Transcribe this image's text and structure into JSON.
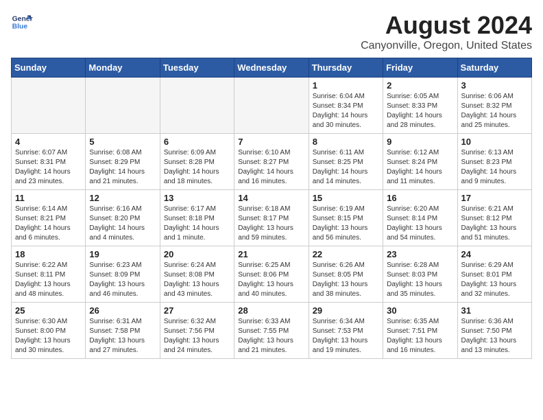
{
  "header": {
    "logo_line1": "General",
    "logo_line2": "Blue",
    "month_year": "August 2024",
    "location": "Canyonville, Oregon, United States"
  },
  "weekdays": [
    "Sunday",
    "Monday",
    "Tuesday",
    "Wednesday",
    "Thursday",
    "Friday",
    "Saturday"
  ],
  "weeks": [
    [
      {
        "day": "",
        "info": ""
      },
      {
        "day": "",
        "info": ""
      },
      {
        "day": "",
        "info": ""
      },
      {
        "day": "",
        "info": ""
      },
      {
        "day": "1",
        "info": "Sunrise: 6:04 AM\nSunset: 8:34 PM\nDaylight: 14 hours\nand 30 minutes."
      },
      {
        "day": "2",
        "info": "Sunrise: 6:05 AM\nSunset: 8:33 PM\nDaylight: 14 hours\nand 28 minutes."
      },
      {
        "day": "3",
        "info": "Sunrise: 6:06 AM\nSunset: 8:32 PM\nDaylight: 14 hours\nand 25 minutes."
      }
    ],
    [
      {
        "day": "4",
        "info": "Sunrise: 6:07 AM\nSunset: 8:31 PM\nDaylight: 14 hours\nand 23 minutes."
      },
      {
        "day": "5",
        "info": "Sunrise: 6:08 AM\nSunset: 8:29 PM\nDaylight: 14 hours\nand 21 minutes."
      },
      {
        "day": "6",
        "info": "Sunrise: 6:09 AM\nSunset: 8:28 PM\nDaylight: 14 hours\nand 18 minutes."
      },
      {
        "day": "7",
        "info": "Sunrise: 6:10 AM\nSunset: 8:27 PM\nDaylight: 14 hours\nand 16 minutes."
      },
      {
        "day": "8",
        "info": "Sunrise: 6:11 AM\nSunset: 8:25 PM\nDaylight: 14 hours\nand 14 minutes."
      },
      {
        "day": "9",
        "info": "Sunrise: 6:12 AM\nSunset: 8:24 PM\nDaylight: 14 hours\nand 11 minutes."
      },
      {
        "day": "10",
        "info": "Sunrise: 6:13 AM\nSunset: 8:23 PM\nDaylight: 14 hours\nand 9 minutes."
      }
    ],
    [
      {
        "day": "11",
        "info": "Sunrise: 6:14 AM\nSunset: 8:21 PM\nDaylight: 14 hours\nand 6 minutes."
      },
      {
        "day": "12",
        "info": "Sunrise: 6:16 AM\nSunset: 8:20 PM\nDaylight: 14 hours\nand 4 minutes."
      },
      {
        "day": "13",
        "info": "Sunrise: 6:17 AM\nSunset: 8:18 PM\nDaylight: 14 hours\nand 1 minute."
      },
      {
        "day": "14",
        "info": "Sunrise: 6:18 AM\nSunset: 8:17 PM\nDaylight: 13 hours\nand 59 minutes."
      },
      {
        "day": "15",
        "info": "Sunrise: 6:19 AM\nSunset: 8:15 PM\nDaylight: 13 hours\nand 56 minutes."
      },
      {
        "day": "16",
        "info": "Sunrise: 6:20 AM\nSunset: 8:14 PM\nDaylight: 13 hours\nand 54 minutes."
      },
      {
        "day": "17",
        "info": "Sunrise: 6:21 AM\nSunset: 8:12 PM\nDaylight: 13 hours\nand 51 minutes."
      }
    ],
    [
      {
        "day": "18",
        "info": "Sunrise: 6:22 AM\nSunset: 8:11 PM\nDaylight: 13 hours\nand 48 minutes."
      },
      {
        "day": "19",
        "info": "Sunrise: 6:23 AM\nSunset: 8:09 PM\nDaylight: 13 hours\nand 46 minutes."
      },
      {
        "day": "20",
        "info": "Sunrise: 6:24 AM\nSunset: 8:08 PM\nDaylight: 13 hours\nand 43 minutes."
      },
      {
        "day": "21",
        "info": "Sunrise: 6:25 AM\nSunset: 8:06 PM\nDaylight: 13 hours\nand 40 minutes."
      },
      {
        "day": "22",
        "info": "Sunrise: 6:26 AM\nSunset: 8:05 PM\nDaylight: 13 hours\nand 38 minutes."
      },
      {
        "day": "23",
        "info": "Sunrise: 6:28 AM\nSunset: 8:03 PM\nDaylight: 13 hours\nand 35 minutes."
      },
      {
        "day": "24",
        "info": "Sunrise: 6:29 AM\nSunset: 8:01 PM\nDaylight: 13 hours\nand 32 minutes."
      }
    ],
    [
      {
        "day": "25",
        "info": "Sunrise: 6:30 AM\nSunset: 8:00 PM\nDaylight: 13 hours\nand 30 minutes."
      },
      {
        "day": "26",
        "info": "Sunrise: 6:31 AM\nSunset: 7:58 PM\nDaylight: 13 hours\nand 27 minutes."
      },
      {
        "day": "27",
        "info": "Sunrise: 6:32 AM\nSunset: 7:56 PM\nDaylight: 13 hours\nand 24 minutes."
      },
      {
        "day": "28",
        "info": "Sunrise: 6:33 AM\nSunset: 7:55 PM\nDaylight: 13 hours\nand 21 minutes."
      },
      {
        "day": "29",
        "info": "Sunrise: 6:34 AM\nSunset: 7:53 PM\nDaylight: 13 hours\nand 19 minutes."
      },
      {
        "day": "30",
        "info": "Sunrise: 6:35 AM\nSunset: 7:51 PM\nDaylight: 13 hours\nand 16 minutes."
      },
      {
        "day": "31",
        "info": "Sunrise: 6:36 AM\nSunset: 7:50 PM\nDaylight: 13 hours\nand 13 minutes."
      }
    ]
  ]
}
